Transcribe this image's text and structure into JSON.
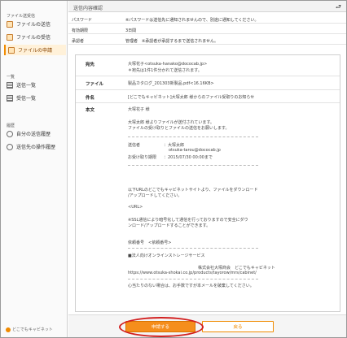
{
  "sidebar": {
    "section_files": "ファイル送受信",
    "items_files": [
      {
        "label": "ファイルの送信"
      },
      {
        "label": "ファイルの受信"
      },
      {
        "label": "ファイルの申請"
      }
    ],
    "section_list": "一覧",
    "items_list": [
      {
        "label": "送信一覧"
      },
      {
        "label": "受信一覧"
      }
    ],
    "section_history": "履歴",
    "items_history": [
      {
        "label": "自分の送信履歴"
      },
      {
        "label": "送信先の操作履歴"
      }
    ],
    "brand": "どこでもキャビネット"
  },
  "header": {
    "title": "送信内容確認",
    "back_icon": "return-arrow"
  },
  "info": [
    {
      "key": "パスワード",
      "value": "※パスワードは送信先に通知されませんので、別途に通知してください。"
    },
    {
      "key": "有効期限",
      "value": "3日間"
    },
    {
      "key": "承認者",
      "value": "管理者　※承認者が承認するまで送信されません。"
    }
  ],
  "mail": {
    "to_label": "宛先",
    "to_value": "大塚花子<otsuka-hanako@dococab.jp>",
    "to_note": "＊宛先は1件1件分かれて送信されます。",
    "file_label": "ファイル",
    "file_value": "製品カタログ_201303新製品.pdf<16.16KB>",
    "subject_label": "件名",
    "subject_value": "[どこでもキャビネット]大塚太郎 様からのファイル受取りのお知らせ",
    "body_label": "本文",
    "body": {
      "greeting": "大塚花子 様",
      "intro1": "大塚太郎 様よりファイルが送付されています。",
      "intro2": "ファイルの受け取りとファイルの送信をお願いします。",
      "sender_label": "送信者",
      "sender_value": "：大塚太郎",
      "sender_mail": "otsuka-tarou@dococab.jp",
      "deadline_label": "お受け取り期限",
      "deadline_value": "：2015/07/30 00:00まで",
      "url_text1": "以下URLのどこでもキャビネットサイトより、ファイルをダウンロード",
      "url_text2": "/アップロードしてください。",
      "url_placeholder": "<URL>",
      "ssl1": "※SSL通信により暗号化して通信を行っておりますので安全にダウ",
      "ssl2": "ンロード/アップロードすることができます。",
      "request_no": "依頼番号　<依頼番号>",
      "corp_line": "■法人向けオンラインストレージサービス",
      "company": "株式会社大塚商会　どこでもキャビネット",
      "company_url": "https://www.otsuka-shokai.co.jp/products/tayorow/mrs/cabinet/",
      "notice": "心当たりのない場合は、お手数ですが本メールを破棄してください。"
    }
  },
  "footer": {
    "apply_label": "申請する",
    "back_label": "戻る"
  }
}
